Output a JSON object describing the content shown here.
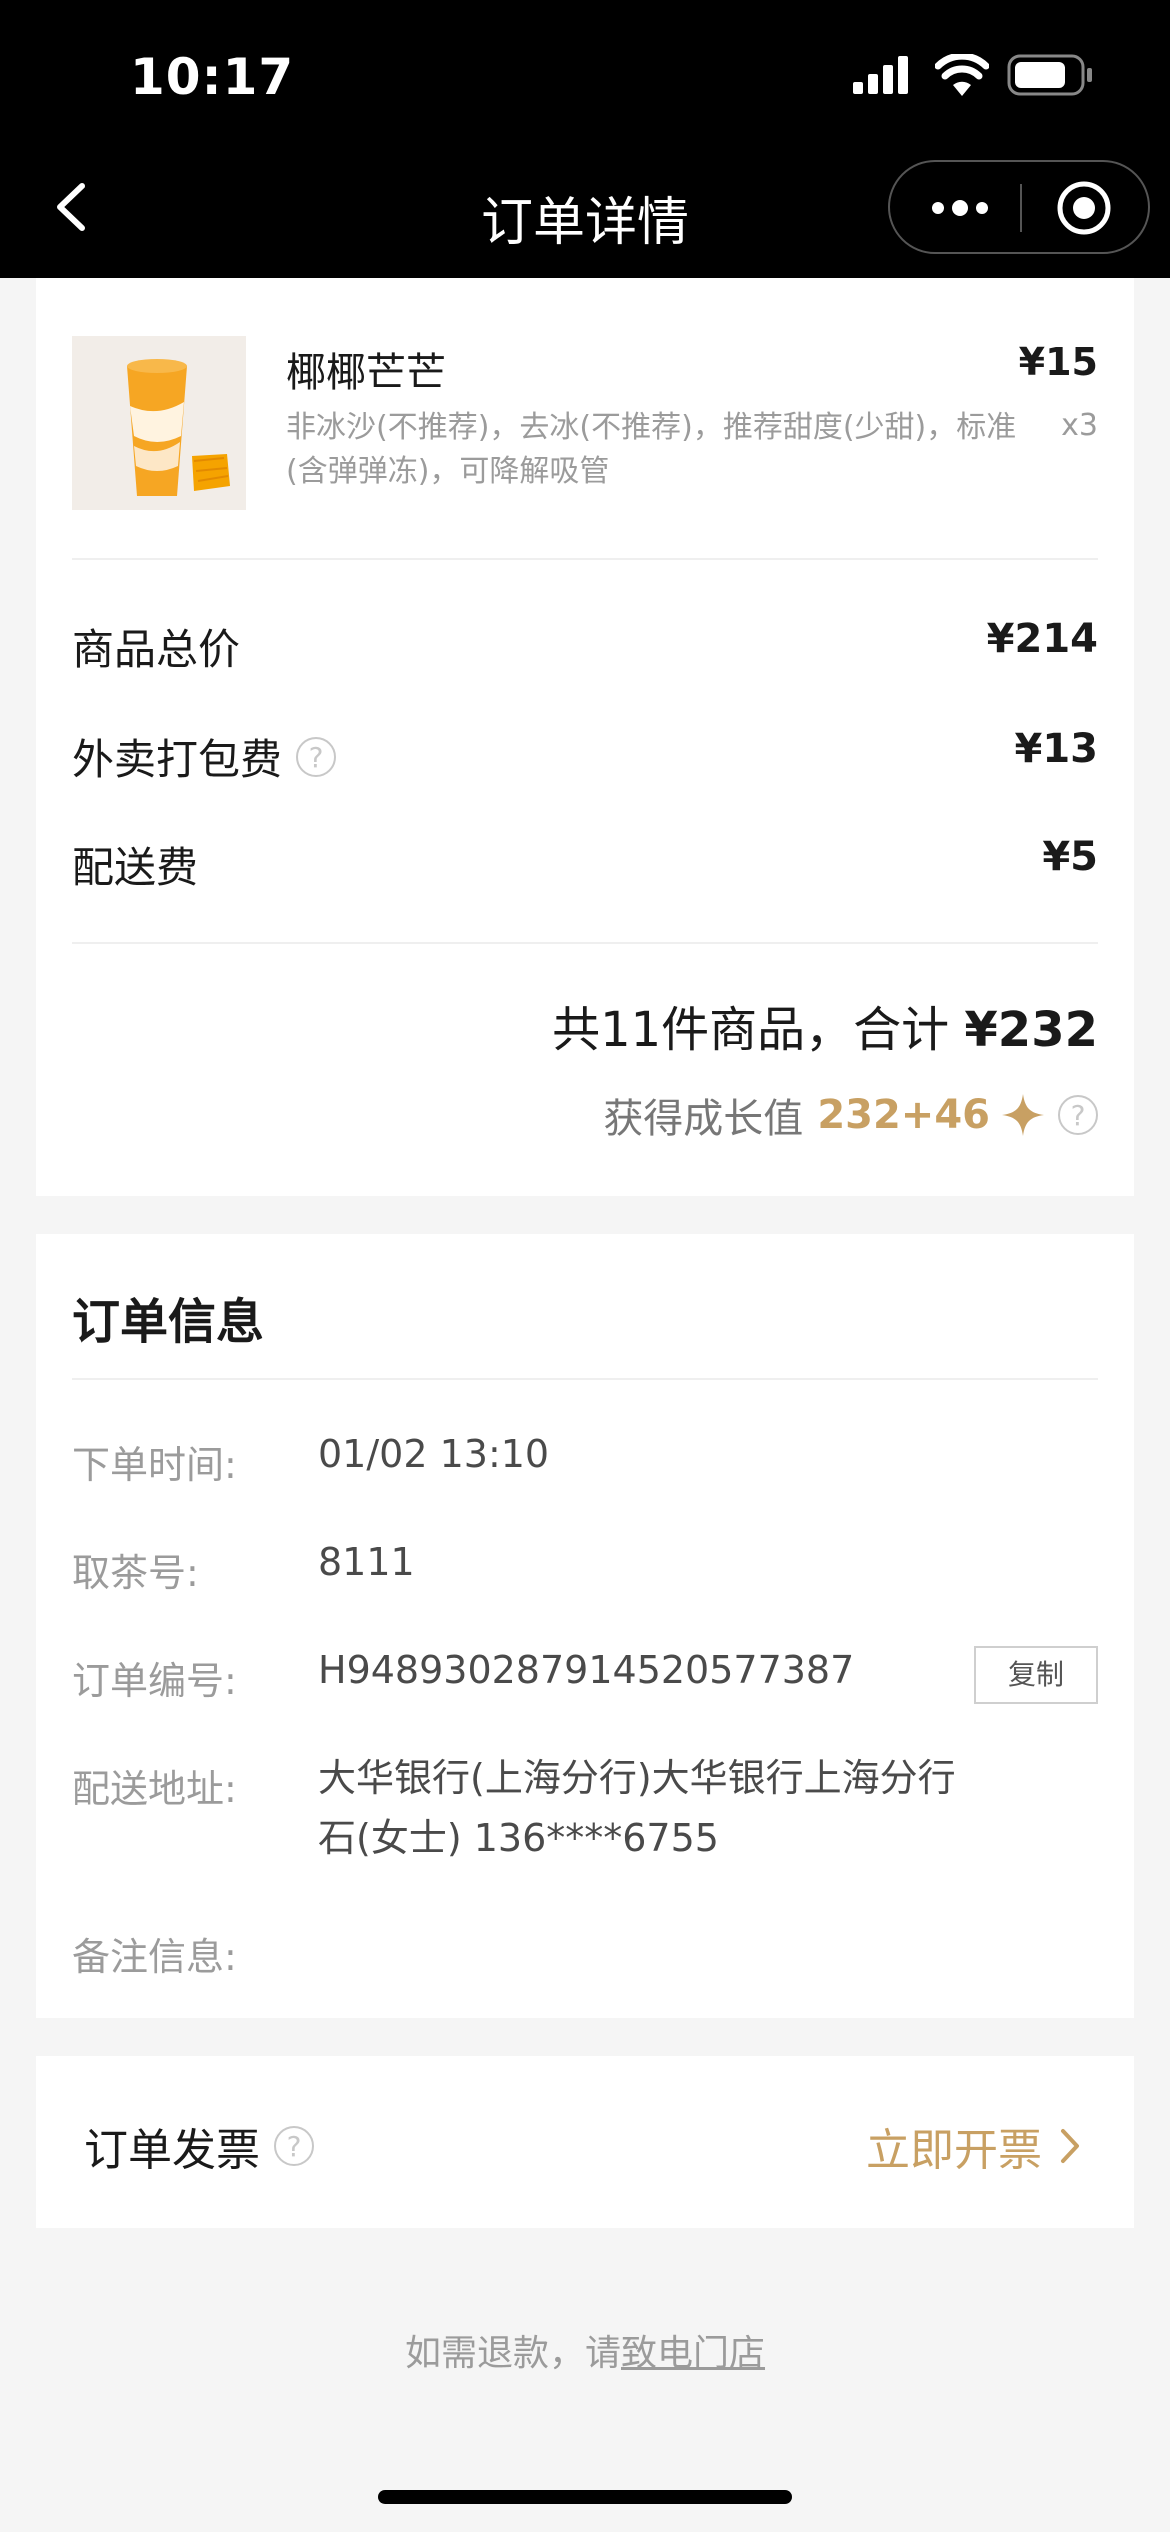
{
  "status": {
    "time": "10:17"
  },
  "nav": {
    "title": "订单详情"
  },
  "item": {
    "name": "椰椰芒芒",
    "spec": "非冰沙(不推荐)，去冰(不推荐)，推荐甜度(少甜)，标准(含弹弹冻)，可降解吸管",
    "price": "¥15",
    "qty": "x3"
  },
  "summary": {
    "goods_total_label": "商品总价",
    "goods_total_value": "¥214",
    "packing_label": "外卖打包费",
    "packing_value": "¥13",
    "delivery_label": "配送费",
    "delivery_value": "¥5",
    "total_prefix": "共11件商品，合计 ",
    "total_amount": "¥232",
    "growth_label": "获得成长值",
    "growth_value": "232+46"
  },
  "order_info": {
    "title": "订单信息",
    "time_label": "下单时间:",
    "time_value": "01/02 13:10",
    "pickup_label": "取茶号:",
    "pickup_value": "8111",
    "order_no_label": "订单编号:",
    "order_no_value": "H948930287914520577387",
    "copy_label": "复制",
    "address_label": "配送地址:",
    "address_line1": "大华银行(上海分行)大华银行上海分行",
    "address_line2": "石(女士) 136****6755",
    "remark_label": "备注信息:"
  },
  "invoice": {
    "label": "订单发票",
    "action": "立即开票"
  },
  "footer": {
    "refund_prefix": "如需退款，请",
    "refund_link": "致电门店"
  },
  "colors": {
    "accent": "#c8a063"
  }
}
